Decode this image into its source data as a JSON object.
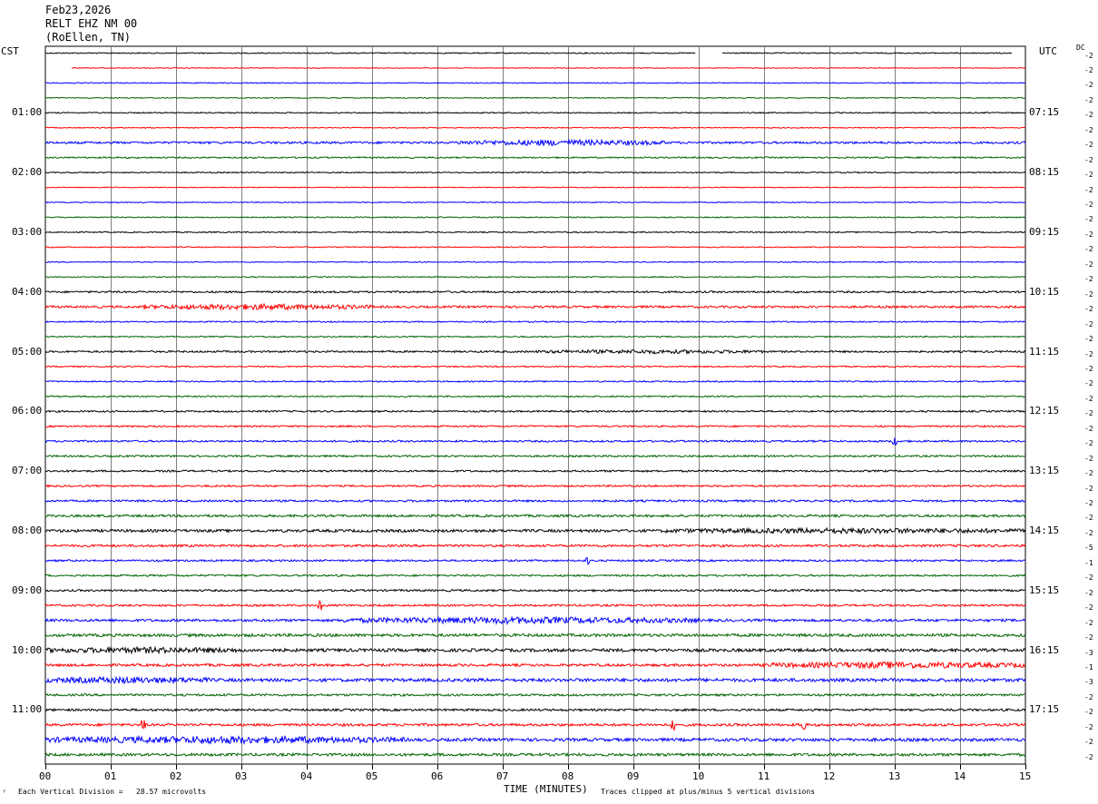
{
  "header": {
    "date": "Feb23,2026",
    "station": "RELT EHZ NM 00",
    "location": "(RoEllen, TN)"
  },
  "left_zone": "CST",
  "right_zone": "UTC",
  "dc_label": "DC",
  "footer": {
    "scale_note": "Each Vertical Division =   28.57 microvolts",
    "xlabel": "TIME (MINUTES)",
    "clip_note": "Traces clipped at plus/minus 5 vertical divisions",
    "corner_mark": "ˀ"
  },
  "chart_data": {
    "type": "line",
    "title": "Feb23,2026 RELT EHZ NM 00 (RoEllen, TN)",
    "xlabel": "TIME (MINUTES)",
    "xlim": [
      0,
      15
    ],
    "x_ticks": [
      "00",
      "01",
      "02",
      "03",
      "04",
      "05",
      "06",
      "07",
      "08",
      "09",
      "10",
      "11",
      "12",
      "13",
      "14",
      "15"
    ],
    "trace_colors": [
      "#000000",
      "#ff0000",
      "#0000ff",
      "#006400"
    ],
    "num_traces": 48,
    "minutes_per_trace": 15,
    "left_time_labels": [
      {
        "trace": 4,
        "label": "01:00"
      },
      {
        "trace": 8,
        "label": "02:00"
      },
      {
        "trace": 12,
        "label": "03:00"
      },
      {
        "trace": 16,
        "label": "04:00"
      },
      {
        "trace": 20,
        "label": "05:00"
      },
      {
        "trace": 24,
        "label": "06:00"
      },
      {
        "trace": 28,
        "label": "07:00"
      },
      {
        "trace": 32,
        "label": "08:00"
      },
      {
        "trace": 36,
        "label": "09:00"
      },
      {
        "trace": 40,
        "label": "10:00"
      },
      {
        "trace": 44,
        "label": "11:00"
      }
    ],
    "right_time_labels": [
      {
        "trace": 4,
        "label": "07:15"
      },
      {
        "trace": 8,
        "label": "08:15"
      },
      {
        "trace": 12,
        "label": "09:15"
      },
      {
        "trace": 16,
        "label": "10:15"
      },
      {
        "trace": 20,
        "label": "11:15"
      },
      {
        "trace": 24,
        "label": "12:15"
      },
      {
        "trace": 28,
        "label": "13:15"
      },
      {
        "trace": 32,
        "label": "14:15"
      },
      {
        "trace": 36,
        "label": "15:15"
      },
      {
        "trace": 40,
        "label": "16:15"
      },
      {
        "trace": 44,
        "label": "17:15"
      }
    ],
    "dc_offsets": [
      "-2",
      "-2",
      "-2",
      "-2",
      "-2",
      "-2",
      "-2",
      "-2",
      "-2",
      "-2",
      "-2",
      "-2",
      "-2",
      "-2",
      "-2",
      "-2",
      "-2",
      "-2",
      "-2",
      "-2",
      "-2",
      "-2",
      "-2",
      "-2",
      "-2",
      "-2",
      "-2",
      "-2",
      "-2",
      "-2",
      "-2",
      "-2",
      "-2",
      "-5",
      "-1",
      "-2",
      "-2",
      "-2",
      "-2",
      "-2",
      "-3",
      "-1",
      "-3",
      "-2",
      "-2",
      "-2",
      "-2",
      "-2"
    ],
    "trace_noise_amplitude": [
      0.6,
      0.4,
      0.5,
      0.5,
      0.6,
      0.5,
      1.2,
      0.8,
      0.6,
      0.5,
      0.5,
      0.6,
      0.6,
      0.6,
      0.5,
      0.6,
      1.0,
      1.2,
      0.7,
      0.7,
      1.0,
      0.7,
      0.7,
      0.8,
      0.9,
      0.9,
      1.0,
      1.0,
      1.0,
      1.0,
      1.1,
      1.3,
      1.5,
      1.3,
      1.0,
      1.0,
      1.1,
      1.1,
      1.4,
      1.6,
      1.7,
      1.4,
      1.8,
      1.2,
      1.2,
      1.4,
      1.7,
      1.5
    ],
    "events": [
      {
        "trace": 6,
        "start_min": 6.3,
        "end_min": 9.5,
        "amp": 2.2
      },
      {
        "trace": 17,
        "start_min": 1.5,
        "end_min": 5.0,
        "amp": 2.2
      },
      {
        "trace": 20,
        "start_min": 7.5,
        "end_min": 11.0,
        "amp": 1.3
      },
      {
        "trace": 32,
        "start_min": 9.5,
        "end_min": 15.0,
        "amp": 1.6
      },
      {
        "trace": 38,
        "start_min": 4.5,
        "end_min": 10.0,
        "amp": 2.5
      },
      {
        "trace": 40,
        "start_min": 0.0,
        "end_min": 3.0,
        "amp": 1.8
      },
      {
        "trace": 41,
        "start_min": 11.0,
        "end_min": 15.0,
        "amp": 2.4
      },
      {
        "trace": 42,
        "start_min": 0.0,
        "end_min": 2.5,
        "amp": 2.0
      },
      {
        "trace": 46,
        "start_min": 0.0,
        "end_min": 5.5,
        "amp": 2.6
      }
    ],
    "spikes": [
      {
        "trace": 37,
        "min": 4.2,
        "amp": 4
      },
      {
        "trace": 45,
        "min": 9.6,
        "amp": 5
      },
      {
        "trace": 45,
        "min": 11.6,
        "amp": 4
      },
      {
        "trace": 45,
        "min": 1.5,
        "amp": 4
      },
      {
        "trace": 26,
        "min": 13.0,
        "amp": 3
      },
      {
        "trace": 34,
        "min": 8.3,
        "amp": 3
      }
    ],
    "gaps": [
      {
        "trace": 0,
        "start_min": 9.95,
        "end_min": 10.35
      },
      {
        "trace": 0,
        "start_min": 14.8,
        "end_min": 15.0
      },
      {
        "trace": 1,
        "start_min": 0.0,
        "end_min": 0.4
      }
    ]
  }
}
